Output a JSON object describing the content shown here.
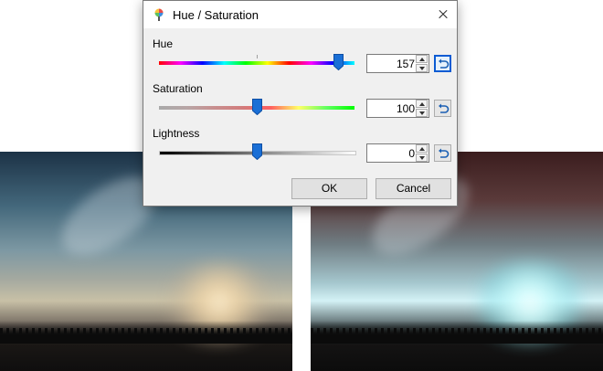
{
  "dialog": {
    "title": "Hue / Saturation",
    "hue": {
      "label": "Hue",
      "value": "157",
      "position": 0.92
    },
    "saturation": {
      "label": "Saturation",
      "value": "100",
      "position": 0.5
    },
    "lightness": {
      "label": "Lightness",
      "value": "0",
      "position": 0.5
    },
    "ok_label": "OK",
    "cancel_label": "Cancel"
  },
  "colors": {
    "accent": "#0a5bd3",
    "thumb": "#1a6fd6",
    "dialog_bg": "#f0f0f0"
  },
  "icons": {
    "app": "palette-brush-icon",
    "close": "close-icon",
    "reset": "reset-arrow-icon",
    "spin_up": "spin-up-icon",
    "spin_down": "spin-down-icon"
  }
}
